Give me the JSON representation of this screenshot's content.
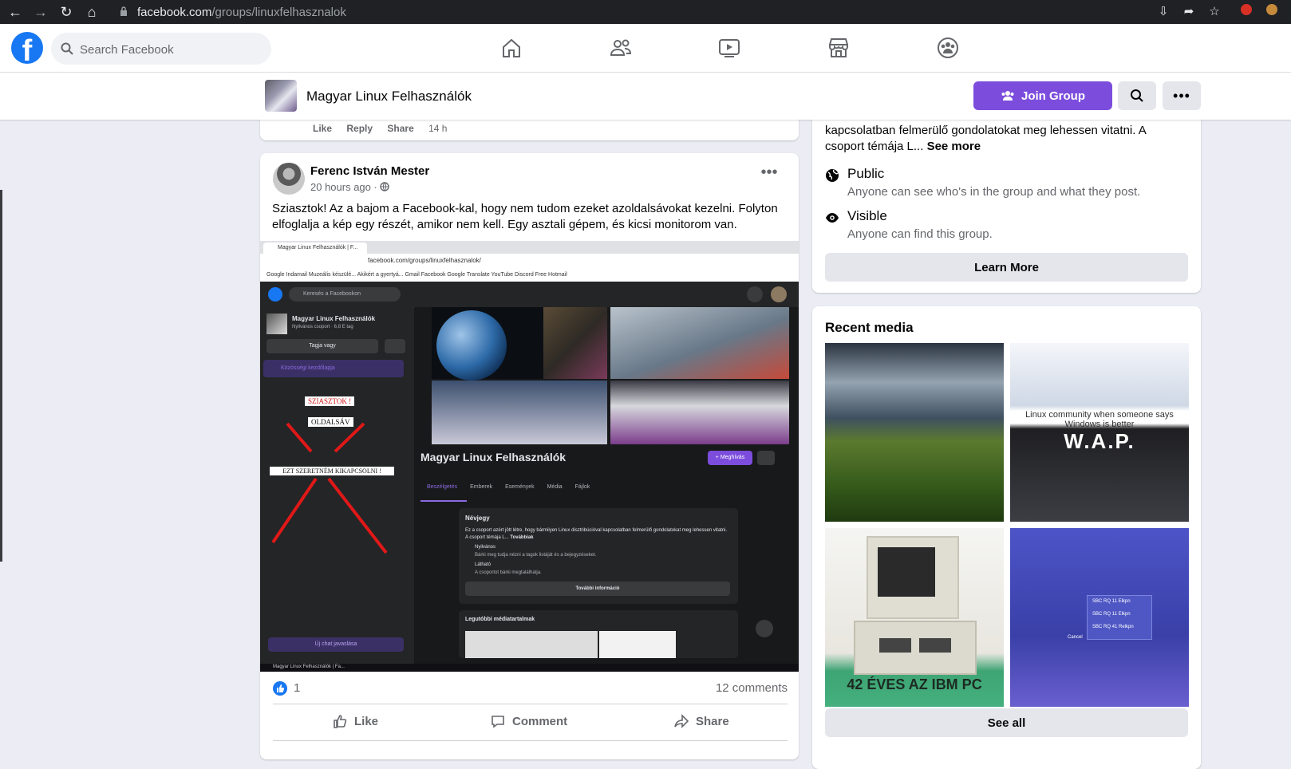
{
  "browser": {
    "url_domain": "facebook.com",
    "url_path": "/groups/linuxfelhasznalok"
  },
  "topbar": {
    "search_placeholder": "Search Facebook"
  },
  "group": {
    "title": "Magyar Linux Felhasználók",
    "join_label": "Join Group"
  },
  "prev_post": {
    "actions": [
      "Like",
      "Reply",
      "Share"
    ],
    "time": "14 h"
  },
  "post": {
    "author": "Ferenc István Mester",
    "time": "20 hours ago · ",
    "text": "Sziasztok! Az a bajom a Facebook-kal, hogy nem tudom ezeket azoldalsávokat kezelni. Folyton elfoglalja a kép egy részét, amikor nem kell. Egy asztali gépem, és kicsi monitorom van.",
    "reaction_count": "1",
    "comments": "12 comments",
    "like_label": "Like",
    "comment_label": "Comment",
    "share_label": "Share"
  },
  "screenshot": {
    "tab_title": "Magyar Linux Felhasználók | F...",
    "url": "facebook.com/groups/linuxfelhasznalok/",
    "bookmarks": "Google   Indamail   Muzeális készülé...   Akikért a gyertyá...   Gmail   Facebook   Google Translate   YouTube   Discord   Free Hotmail",
    "search_placeholder": "Keresés a Facebookon",
    "group_name": "Magyar Linux Felhasználók",
    "group_meta": "Nyilvános csoport · 6,8 E tag",
    "member_label": "Tagja vagy",
    "feed_label": "Közösségi kezdőlapja",
    "note1": "SZIASZTOK !",
    "note2": "OLDALSÁV",
    "note3": "EZT SZERETNÉM KIKAPCSOLNI !",
    "new_chat": "Új chat javaslása",
    "invite": "+ Meghívás",
    "tabs": [
      "Beszélgetés",
      "Emberek",
      "Események",
      "Média",
      "Fájlok"
    ],
    "about_title": "Névjegy",
    "about_text": "Ez a csoport azért jött létre, hogy bármilyen Linux disztribúcióval kapcsolatban felmerülő gondolatokat meg lehessen vitatni. A csoport témája L...",
    "about_more": "Továbbiak",
    "public_title": "Nyilvános",
    "public_sub": "Bárki meg tudja nézni a tagok listáját és a bejegyzéseket.",
    "visible_title": "Látható",
    "visible_sub": "A csoportot bárki megtalálhatja.",
    "more_info": "További információ",
    "recent_media": "Legutóbbi médiatartalmak",
    "taskbar": "Magyar Linux Felhasználók | Fa..."
  },
  "about": {
    "desc": "kapcsolatban felmerülő gondolatokat meg lehessen vitatni. A csoport témája L...",
    "see_more": "See more",
    "public_title": "Public",
    "public_sub": "Anyone can see who's in the group and what they post.",
    "visible_title": "Visible",
    "visible_sub": "Anyone can find this group.",
    "learn_more": "Learn More"
  },
  "media": {
    "title": "Recent media",
    "tile2_caption": "Linux community when someone says Windows is better",
    "tile2_big": "W.A.P.",
    "tile3_caption": "42 ÉVES AZ IBM PC",
    "tile4_items": [
      "SBC RQ 11 Elkpn",
      "SBC RQ 11 Elkpn",
      "SBC RQ 41 Relkpn"
    ],
    "tile4_cancel": "Cancel",
    "see_all": "See all"
  },
  "colors": {
    "brand": "#1877f2",
    "join": "#7c4ddc"
  }
}
